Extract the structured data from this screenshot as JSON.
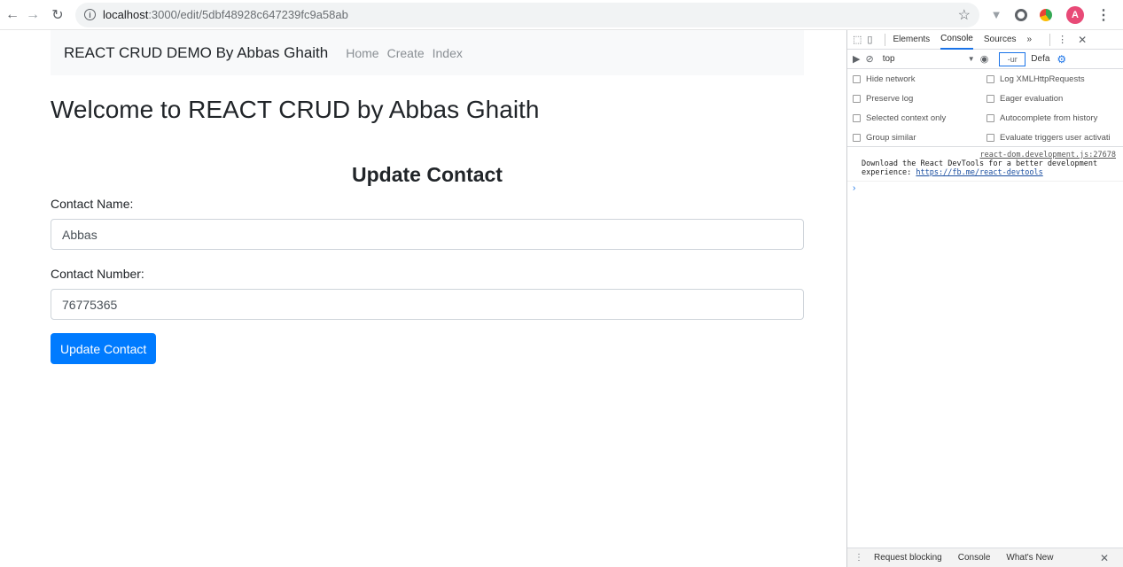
{
  "browser": {
    "url_host": "localhost",
    "url_path": ":3000/edit/5dbf48928c647239fc9a58ab",
    "avatar_letter": "A"
  },
  "navbar": {
    "brand": "REACT CRUD DEMO By Abbas Ghaith",
    "links": [
      "Home",
      "Create",
      "Index"
    ]
  },
  "page": {
    "welcome": "Welcome to REACT CRUD by Abbas Ghaith",
    "form_title": "Update Contact",
    "name_label": "Contact Name:",
    "name_value": "Abbas",
    "number_label": "Contact Number:",
    "number_value": "76775365",
    "submit_label": "Update Contact",
    "primary_color": "#007bff"
  },
  "devtools": {
    "tabs": [
      "Elements",
      "Console",
      "Sources",
      "»"
    ],
    "active_tab": "Console",
    "context": "top",
    "filter_placeholder": "-ur",
    "levels": "Defa",
    "settings": {
      "hide_network": "Hide network",
      "preserve_log": "Preserve log",
      "selected_context": "Selected context only",
      "group_similar": "Group similar",
      "log_xhr": "Log XMLHttpRequests",
      "eager_eval": "Eager evaluation",
      "autocomplete": "Autocomplete from history",
      "eval_triggers": "Evaluate triggers user activati"
    },
    "message": {
      "source": "react-dom.development.js:27678",
      "text": "Download the React DevTools for a better development experience: ",
      "link": "https://fb.me/react-devtools"
    },
    "drawer_tabs": [
      "Request blocking",
      "Console",
      "What's New"
    ]
  }
}
